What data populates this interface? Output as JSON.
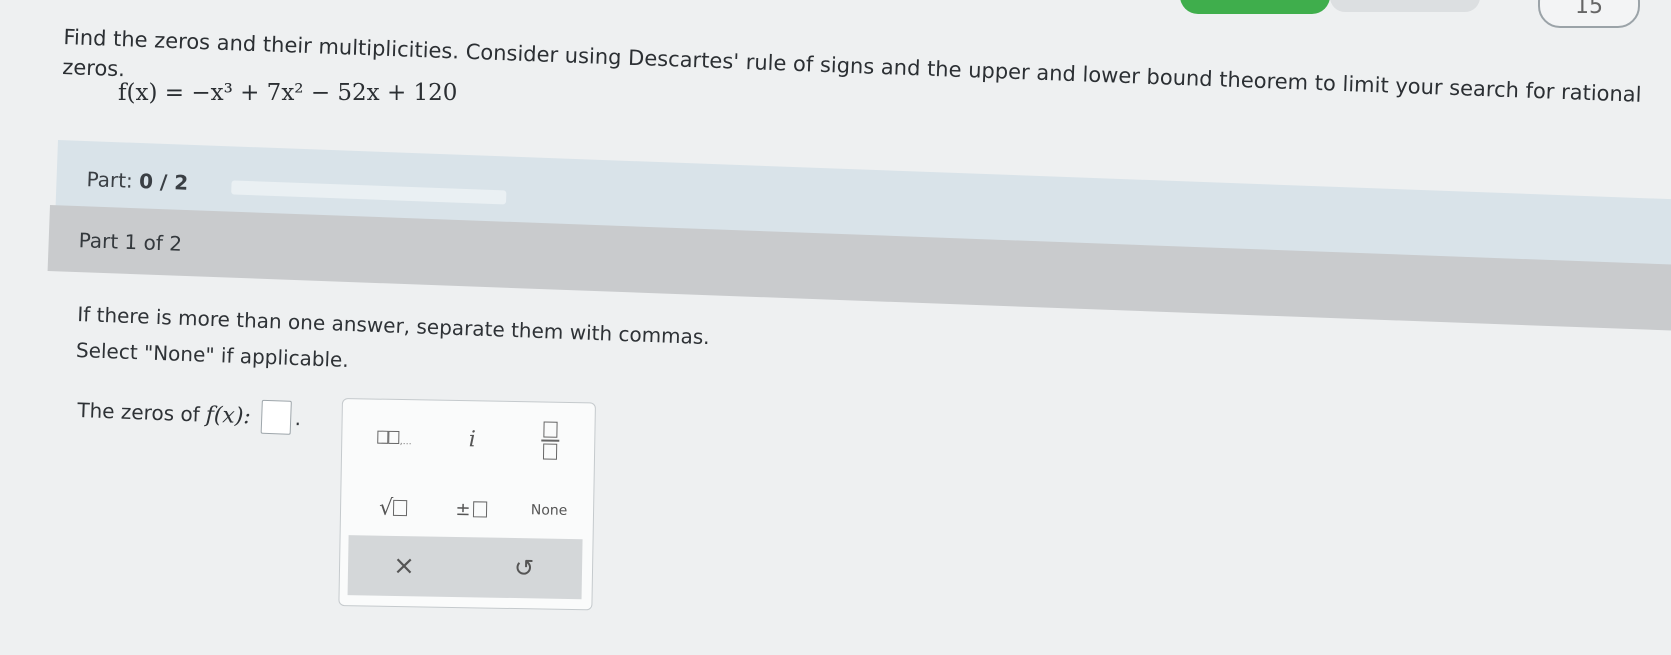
{
  "header": {
    "question_number": "15"
  },
  "question": {
    "prompt": "Find the zeros and their multiplicities. Consider using Descartes' rule of signs and the upper and lower bound theorem to limit your search for rational zeros.",
    "formula": "f(x) = −x³ + 7x² − 52x + 120"
  },
  "progress": {
    "label": "Part:",
    "value_text": "0 / 2",
    "fraction": 0
  },
  "section": {
    "title": "Part 1 of 2"
  },
  "instructions": {
    "line1": "If there is more than one answer, separate them with commas.",
    "line2": "Select \"None\" if applicable."
  },
  "answer": {
    "label": "The zeros of",
    "function": "f(x):",
    "value": ""
  },
  "keypad": {
    "keys": [
      {
        "name": "list-key",
        "icon": "list-icon"
      },
      {
        "name": "imaginary-unit-key",
        "label": "i"
      },
      {
        "name": "fraction-key",
        "icon": "fraction-icon"
      },
      {
        "name": "square-root-key",
        "label": "√"
      },
      {
        "name": "plus-minus-key",
        "label": "±"
      },
      {
        "name": "none-key",
        "label": "None"
      }
    ],
    "clear_label": "×",
    "undo_label": "↺"
  }
}
